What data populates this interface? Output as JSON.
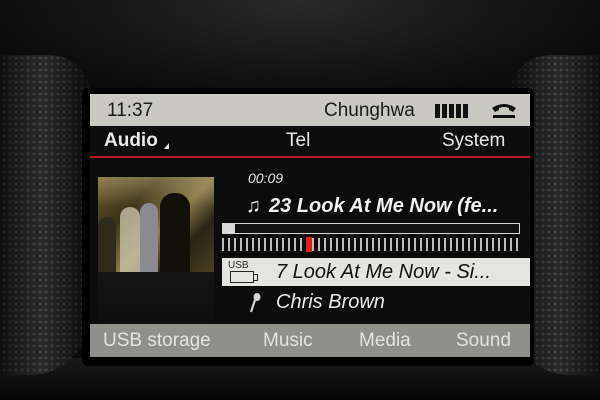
{
  "status_bar": {
    "time": "11:37",
    "carrier": "Chunghwa",
    "signal_bars": 5,
    "call_icon": "phone-handset-icon"
  },
  "menu": {
    "audio": "Audio",
    "tel": "Tel",
    "system": "System"
  },
  "now_playing": {
    "elapsed": "00:09",
    "track": "23 Look At Me Now (fe...",
    "progress_fraction": 0.04,
    "scrubber_position_fraction": 0.29,
    "usb_label": "USB",
    "usb_track": "7  Look At Me Now - Si...",
    "artist": "Chris Brown"
  },
  "bottom_bar": {
    "usb_storage": "USB storage",
    "music": "Music",
    "media": "Media",
    "sound": "Sound"
  },
  "colors": {
    "accent": "#b0161a",
    "knob": "#e0201a",
    "status_bg": "#c9c9c2",
    "bottom_bg": "#8f8f8b"
  }
}
